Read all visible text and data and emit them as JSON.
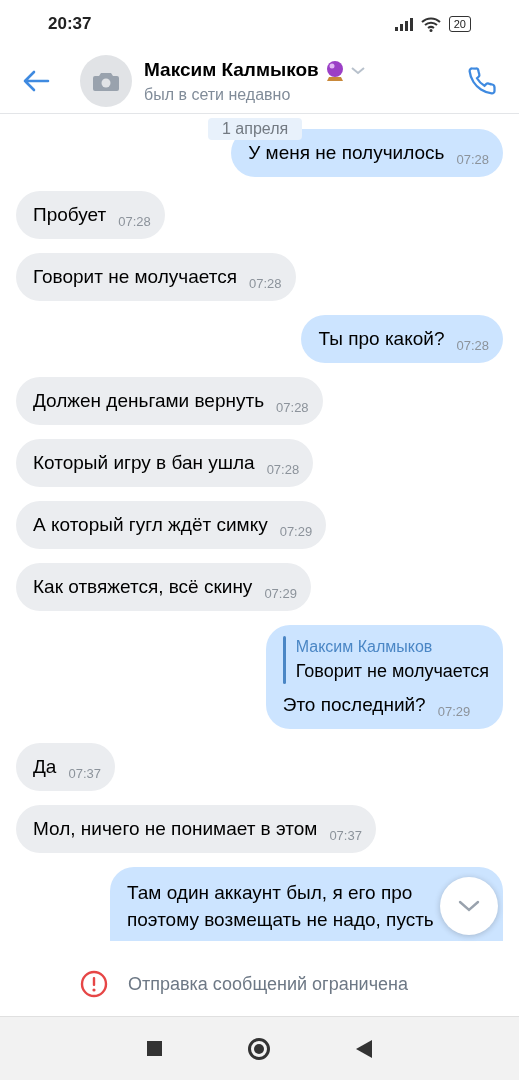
{
  "status_bar": {
    "time": "20:37",
    "battery": "20"
  },
  "header": {
    "name": "Максим Калмыков",
    "status": "был в сети недавно"
  },
  "date_chip": "1 апреля",
  "messages": [
    {
      "kind": "out",
      "text": "У меня не получилось",
      "time": "07:28"
    },
    {
      "kind": "in",
      "text": "Пробует",
      "time": "07:28"
    },
    {
      "kind": "in",
      "text": "Говорит не молучается",
      "time": "07:28"
    },
    {
      "kind": "out",
      "text": "Ты про какой?",
      "time": "07:28"
    },
    {
      "kind": "in",
      "text": "Должен деньгами вернуть",
      "time": "07:28"
    },
    {
      "kind": "in",
      "text": "Который игру в бан ушла",
      "time": "07:28"
    },
    {
      "kind": "in",
      "text": "А который гугл ждёт симку",
      "time": "07:29"
    },
    {
      "kind": "in",
      "text": "Как отвяжется, всё скину",
      "time": "07:29"
    },
    {
      "kind": "out",
      "reply": {
        "author": "Максим Калмыков",
        "text": "Говорит не молучается"
      },
      "text": "Это последний?",
      "time": "07:29"
    },
    {
      "kind": "in",
      "text": "Да",
      "time": "07:37"
    },
    {
      "kind": "in",
      "text": "Мол, ничего не понимает в этом",
      "time": "07:37"
    },
    {
      "kind": "out",
      "lines": [
        "Там один аккаунт был, я его про",
        "поэтому возмещать не надо, пусть"
      ]
    }
  ],
  "restriction": "Отправка сообщений ограничена"
}
